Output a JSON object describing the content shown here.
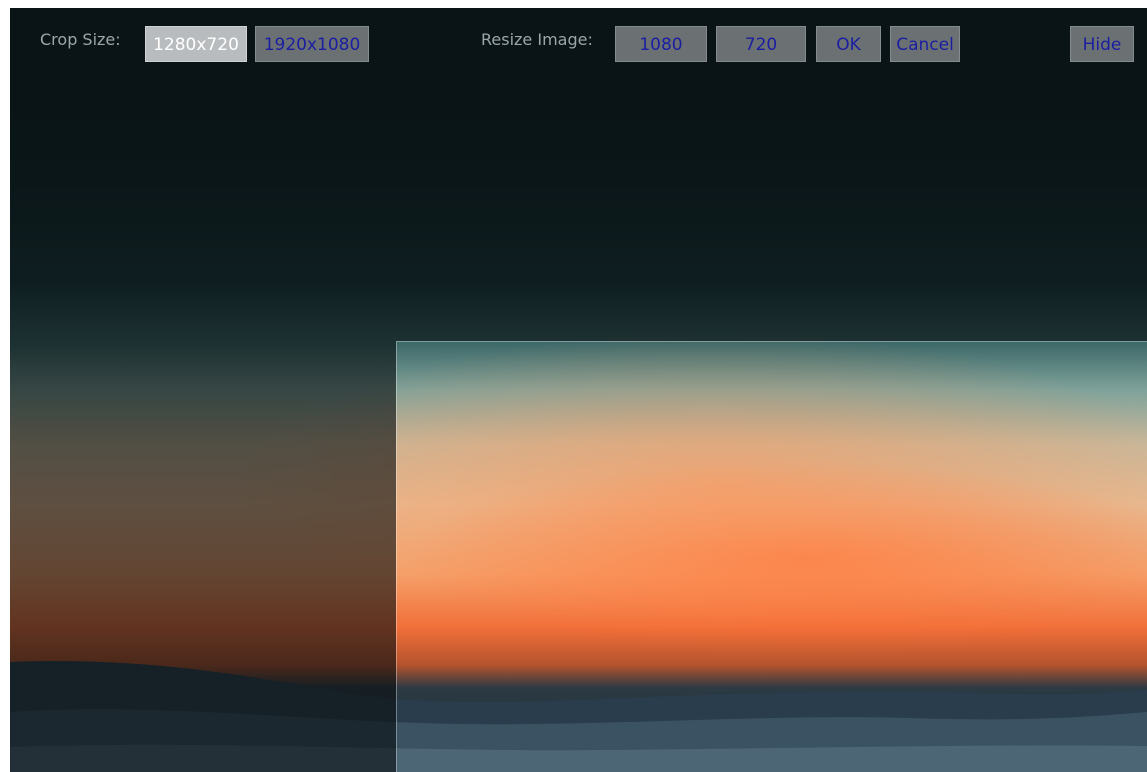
{
  "toolbar": {
    "crop_size_label": "Crop Size:",
    "crop_options": [
      {
        "label": "1280x720",
        "selected": true
      },
      {
        "label": "1920x1080",
        "selected": false
      }
    ],
    "resize_label": "Resize Image:",
    "resize_width_value": "1080",
    "resize_height_value": "720",
    "ok_label": "OK",
    "cancel_label": "Cancel",
    "hide_label": "Hide"
  },
  "colors": {
    "button_bg": "#6b7073",
    "button_text": "#1b1ea0",
    "button_selected_bg": "#b9bcbe",
    "label_text": "#9aa7a8"
  }
}
